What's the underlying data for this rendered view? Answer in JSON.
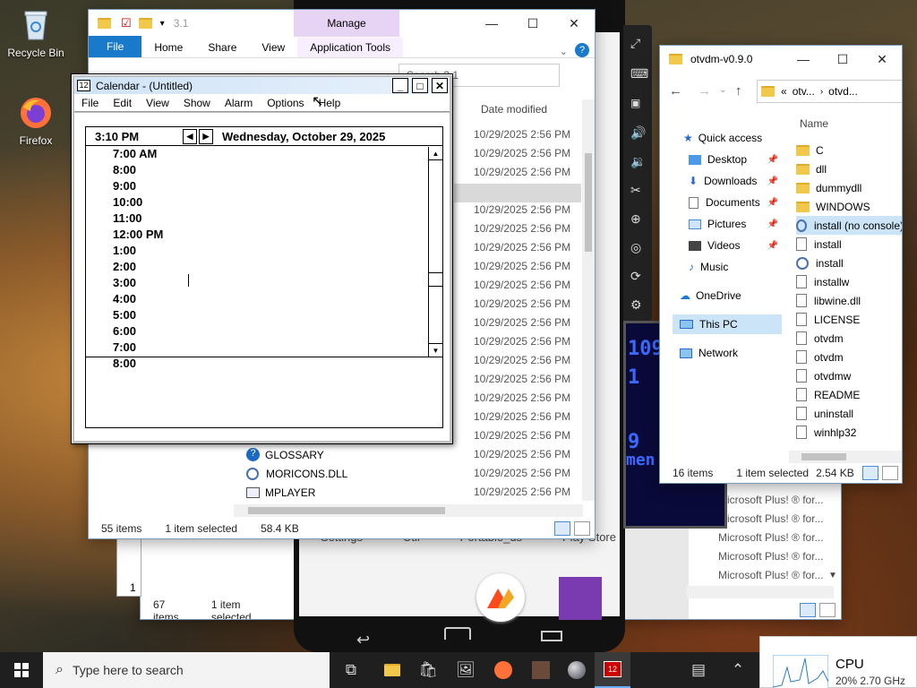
{
  "desktop": {
    "icons": [
      {
        "label": "Recycle Bin"
      },
      {
        "label": "Firefox"
      }
    ]
  },
  "explorer_main": {
    "title_path": "3.1",
    "manage_tab": "Manage",
    "ribbon_tabs": [
      "File",
      "Home",
      "Share",
      "View",
      "Application Tools"
    ],
    "search_placeholder": "Search 3.1",
    "column_date": "Date modified",
    "file_dates": [
      "10/29/2025 2:56 PM",
      "10/29/2025 2:56 PM",
      "10/29/2025 2:56 PM",
      "10/29/2025 2:56 PM",
      "10/29/2025 2:56 PM",
      "10/29/2025 2:56 PM",
      "10/29/2025 2:56 PM",
      "10/29/2025 2:56 PM",
      "10/29/2025 2:56 PM",
      "10/29/2025 2:56 PM",
      "10/29/2025 2:56 PM",
      "10/29/2025 2:56 PM",
      "10/29/2025 2:56 PM",
      "10/29/2025 2:56 PM",
      "10/29/2025 2:56 PM",
      "10/29/2025 2:56 PM",
      "10/29/2025 2:56 PM",
      "10/29/2025 2:56 PM",
      "10/29/2025 2:56 PM",
      "10/29/2025 2:56 PM"
    ],
    "visible_files": [
      "GLOSSARY",
      "MORICONS.DLL",
      "MPLAYER"
    ],
    "status_items": "55 items",
    "status_selected": "1 item selected",
    "status_size": "58.4 KB"
  },
  "explorer_back": {
    "status_items": "67 items",
    "status_selected": "1 item selected",
    "file_types": [
      "Microsoft Plus! ® for...",
      "Microsoft Plus! ® for...",
      "Microsoft Plus! ® for...",
      "Microsoft Plus! ® for...",
      "Microsoft Plus! ® for..."
    ]
  },
  "phone": {
    "bottom_labels": [
      "Settings",
      "Util",
      "Portable_ds",
      "Play Store"
    ]
  },
  "explorer_otvdm": {
    "title": "otvdm-v0.9.0",
    "breadcrumb": [
      "otv...",
      "otvd..."
    ],
    "nav": [
      {
        "label": "Quick access"
      },
      {
        "label": "Desktop"
      },
      {
        "label": "Downloads"
      },
      {
        "label": "Documents"
      },
      {
        "label": "Pictures"
      },
      {
        "label": "Videos"
      },
      {
        "label": "Music"
      },
      {
        "label": "OneDrive"
      },
      {
        "label": "This PC"
      },
      {
        "label": "Network"
      }
    ],
    "column_name": "Name",
    "files": [
      {
        "name": "C",
        "kind": "folder"
      },
      {
        "name": "dll",
        "kind": "folder"
      },
      {
        "name": "dummydll",
        "kind": "folder"
      },
      {
        "name": "WINDOWS",
        "kind": "folder"
      },
      {
        "name": "install (no console)",
        "kind": "script"
      },
      {
        "name": "install",
        "kind": "file"
      },
      {
        "name": "install",
        "kind": "script"
      },
      {
        "name": "installw",
        "kind": "file"
      },
      {
        "name": "libwine.dll",
        "kind": "file"
      },
      {
        "name": "LICENSE",
        "kind": "file"
      },
      {
        "name": "otvdm",
        "kind": "file"
      },
      {
        "name": "otvdm",
        "kind": "file"
      },
      {
        "name": "otvdmw",
        "kind": "file"
      },
      {
        "name": "README",
        "kind": "file"
      },
      {
        "name": "uninstall",
        "kind": "file"
      },
      {
        "name": "winhlp32",
        "kind": "file"
      }
    ],
    "status_items": "16 items",
    "status_selected": "1 item selected",
    "status_size": "2.54 KB"
  },
  "calendar": {
    "title": "Calendar - (Untitled)",
    "menu": [
      "File",
      "Edit",
      "View",
      "Show",
      "Alarm",
      "Options",
      "Help"
    ],
    "current_time": "3:10 PM",
    "date": "Wednesday, October 29, 2025",
    "times": [
      "7:00 AM",
      "8:00",
      "9:00",
      "10:00",
      "11:00",
      "12:00 PM",
      "1:00",
      "2:00",
      "3:00",
      "4:00",
      "5:00",
      "6:00",
      "7:00",
      "8:00"
    ]
  },
  "taskbar": {
    "search_placeholder": "Type here to search",
    "cpu_label": "CPU",
    "cpu_detail": "20%  2.70 GHz"
  }
}
